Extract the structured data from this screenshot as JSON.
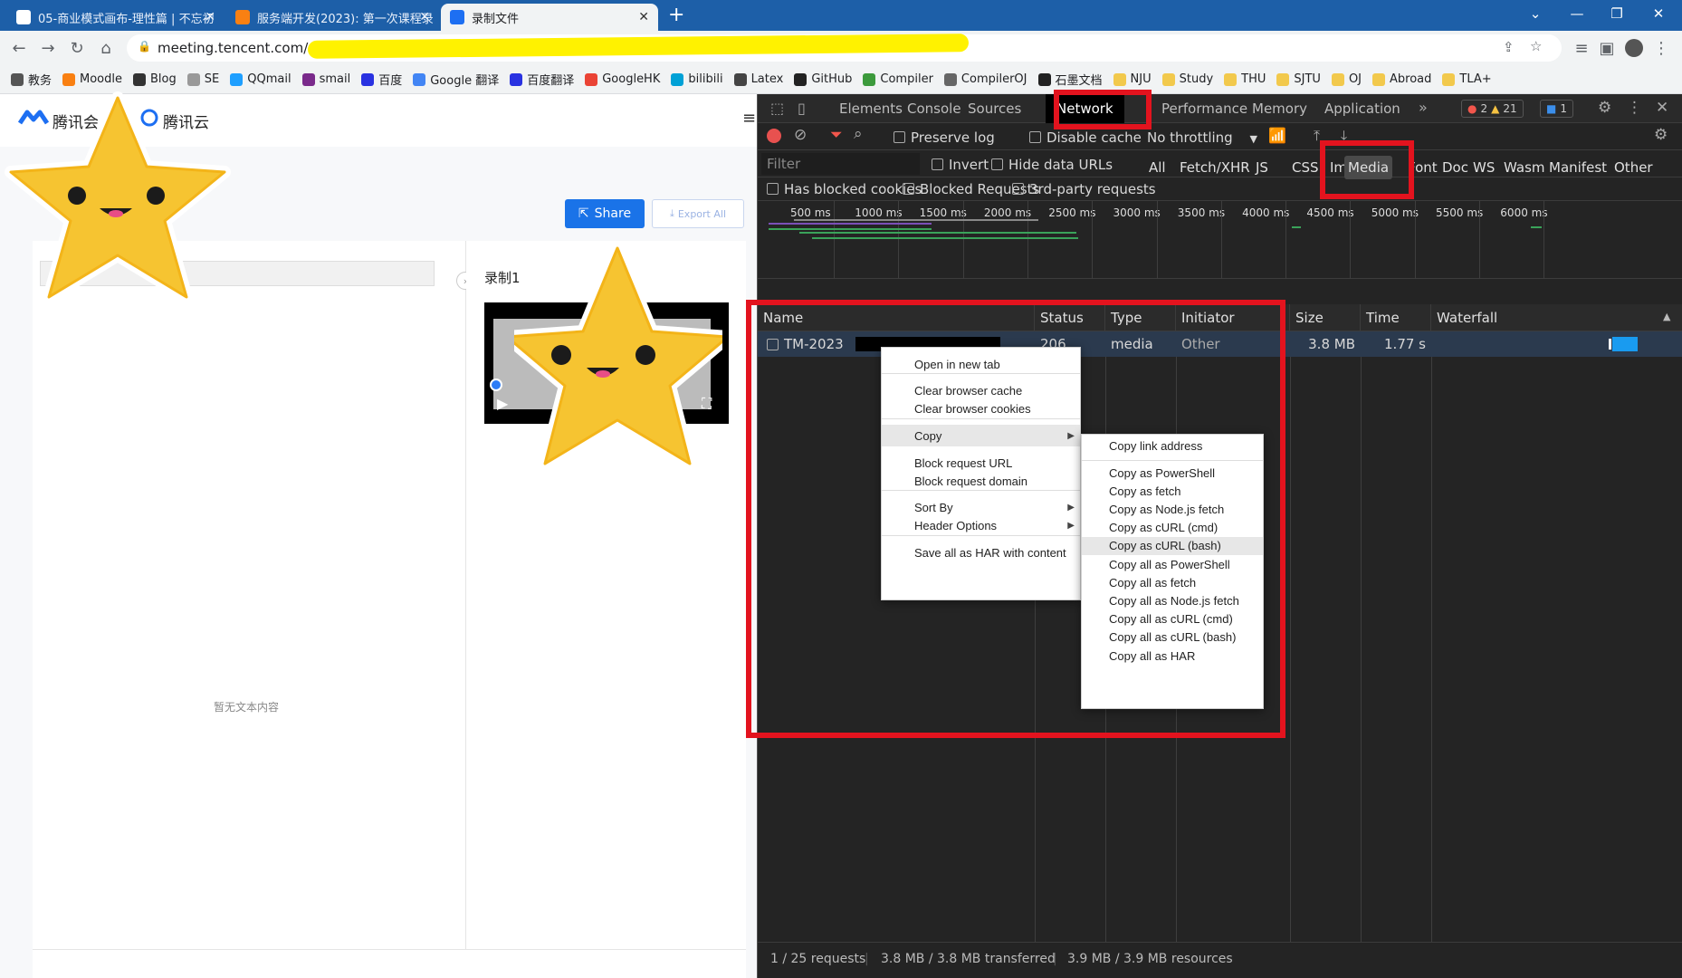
{
  "browser": {
    "tabs": [
      {
        "title": "05-商业模式画布-理性篇 | 不忘初",
        "active": false,
        "icon": "doc-icon"
      },
      {
        "title": "服务端开发(2023): 第一次课程录",
        "active": false,
        "icon": "moodle-icon"
      },
      {
        "title": "录制文件",
        "active": true,
        "icon": "tencent-meeting-icon"
      }
    ],
    "new_tab": "+",
    "url": "meeting.tencent.com/us"
  },
  "bookmarks": [
    {
      "label": "教务",
      "color": "#555"
    },
    {
      "label": "Moodle",
      "color": "#f98012"
    },
    {
      "label": "Blog",
      "color": "#333"
    },
    {
      "label": "SE",
      "color": "#999"
    },
    {
      "label": "QQmail",
      "color": "#1e9fff"
    },
    {
      "label": "smail",
      "color": "#7a2a8b"
    },
    {
      "label": "百度",
      "color": "#2932e1"
    },
    {
      "label": "Google 翻译",
      "color": "#4285f4"
    },
    {
      "label": "百度翻译",
      "color": "#2932e1"
    },
    {
      "label": "GoogleHK",
      "color": "#ea4335"
    },
    {
      "label": "bilibili",
      "color": "#00a1d6"
    },
    {
      "label": "Latex",
      "color": "#444"
    },
    {
      "label": "GitHub",
      "color": "#222"
    },
    {
      "label": "Compiler",
      "color": "#3c9a3c"
    },
    {
      "label": "CompilerOJ",
      "color": "#666"
    },
    {
      "label": "石墨文档",
      "color": "#222"
    },
    {
      "label": "NJU",
      "color": "#f2c94c"
    },
    {
      "label": "Study",
      "color": "#f2c94c"
    },
    {
      "label": "THU",
      "color": "#f2c94c"
    },
    {
      "label": "SJTU",
      "color": "#f2c94c"
    },
    {
      "label": "OJ",
      "color": "#f2c94c"
    },
    {
      "label": "Abroad",
      "color": "#f2c94c"
    },
    {
      "label": "TLA+",
      "color": "#f2c94c"
    }
  ],
  "page": {
    "logo_meeting": "腾讯会",
    "logo_cloud": "腾讯云",
    "share_label": "Share",
    "export_label": "Export All",
    "recording_title": "录制1",
    "empty_text": "暂无文本内容"
  },
  "devtools": {
    "tabs": [
      "Elements",
      "Console",
      "Sources",
      "Network",
      "Performance",
      "Memory",
      "Application"
    ],
    "active_tab": "Network",
    "more": "»",
    "errors": "2",
    "warnings": "21",
    "messages": "1",
    "preserve_log": "Preserve log",
    "disable_cache": "Disable cache",
    "throttling": "No throttling",
    "filter_placeholder": "Filter",
    "invert": "Invert",
    "hide_data_urls": "Hide data URLs",
    "filter_types": [
      "All",
      "Fetch/XHR",
      "JS",
      "CSS",
      "Img",
      "Media",
      "Font",
      "Doc",
      "WS",
      "Wasm",
      "Manifest",
      "Other"
    ],
    "active_filter": "Media",
    "has_blocked_cookies": "Has blocked cookies",
    "blocked_requests": "Blocked Requests",
    "third_party": "3rd-party requests",
    "timeline_ticks": [
      "500 ms",
      "1000 ms",
      "1500 ms",
      "2000 ms",
      "2500 ms",
      "3000 ms",
      "3500 ms",
      "4000 ms",
      "4500 ms",
      "5000 ms",
      "5500 ms",
      "6000 ms"
    ],
    "columns": [
      "Name",
      "Status",
      "Type",
      "Initiator",
      "Size",
      "Time",
      "Waterfall"
    ],
    "request": {
      "name": "TM-2023",
      "status": "206",
      "type": "media",
      "initiator": "Other",
      "size": "3.8 MB",
      "time": "1.77 s"
    },
    "status_bar": {
      "requests": "1 / 25 requests",
      "transferred": "3.8 MB / 3.8 MB transferred",
      "resources": "3.9 MB / 3.9 MB resources"
    }
  },
  "context_menu": {
    "items": [
      "Open in new tab",
      "Clear browser cache",
      "Clear browser cookies",
      "Copy",
      "Block request URL",
      "Block request domain",
      "Sort By",
      "Header Options",
      "Save all as HAR with content"
    ]
  },
  "copy_submenu": {
    "items": [
      "Copy link address",
      "Copy as PowerShell",
      "Copy as fetch",
      "Copy as Node.js fetch",
      "Copy as cURL (cmd)",
      "Copy as cURL (bash)",
      "Copy all as PowerShell",
      "Copy all as fetch",
      "Copy all as Node.js fetch",
      "Copy all as cURL (cmd)",
      "Copy all as cURL (bash)",
      "Copy all as HAR"
    ],
    "highlighted": "Copy as cURL (bash)"
  },
  "colors": {
    "tabstrip": "#1d5fa8",
    "annotation_red": "#e3131e",
    "share_blue": "#1a73e8",
    "highlight_yellow": "#fff200"
  }
}
